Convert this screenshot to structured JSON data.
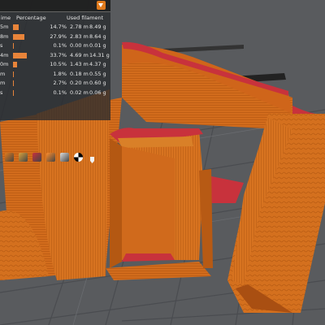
{
  "legend": {
    "headers": {
      "time": "ime",
      "percentage": "Percentage",
      "used_filament": "Used filament"
    },
    "rows": [
      {
        "time": "5m",
        "percentage": 14.7,
        "percentage_label": "14.7%",
        "length": "2.78 m",
        "weight": "8.49 g"
      },
      {
        "time": "8m",
        "percentage": 27.9,
        "percentage_label": "27.9%",
        "length": "2.83 m",
        "weight": "8.64 g"
      },
      {
        "time": "s",
        "percentage": 0.1,
        "percentage_label": "0.1%",
        "length": "0.00 m",
        "weight": "0.01 g"
      },
      {
        "time": "4m",
        "percentage": 33.7,
        "percentage_label": "33.7%",
        "length": "4.69 m",
        "weight": "14.31 g"
      },
      {
        "time": "0m",
        "percentage": 10.5,
        "percentage_label": "10.5%",
        "length": "1.43 m",
        "weight": "4.37 g"
      },
      {
        "time": "m",
        "percentage": 1.8,
        "percentage_label": "1.8%",
        "length": "0.18 m",
        "weight": "0.55 g"
      },
      {
        "time": "m",
        "percentage": 2.7,
        "percentage_label": "2.7%",
        "length": "0.20 m",
        "weight": "0.60 g"
      },
      {
        "time": "s",
        "percentage": 0.1,
        "percentage_label": "0.1%",
        "length": "0.02 m",
        "weight": "0.06 g"
      }
    ]
  },
  "toolbar": {
    "icons": [
      "move-icon",
      "rotate-icon",
      "feature-type-icon",
      "color-icon",
      "tool-icon",
      "checker-icon",
      "layer-marker-icon"
    ]
  },
  "colors": {
    "accent": "#e07a1c",
    "model_orange": "#d06a1a",
    "infill_red": "#c8323c",
    "bed": "#595b5e"
  }
}
